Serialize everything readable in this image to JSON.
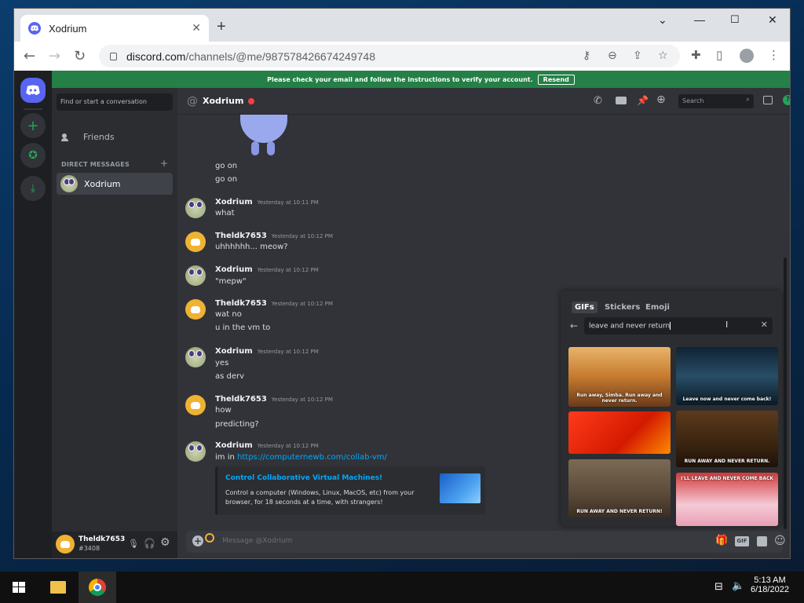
{
  "browser": {
    "tab_title": "Xodrium",
    "url_host": "discord.com",
    "url_path": "/channels/@me/987578426674249748"
  },
  "discord": {
    "banner_text": "Please check your email and follow the instructions to verify your account.",
    "banner_button": "Resend",
    "find_placeholder": "Find or start a conversation",
    "friends_label": "Friends",
    "dm_header": "DIRECT MESSAGES",
    "dm_active": "Xodrium",
    "channel_name": "Xodrium",
    "search_placeholder": "Search",
    "user_name": "Theldk7653",
    "user_tag": "#3408",
    "composer_placeholder": "Message @Xodrium",
    "messages": [
      {
        "name": "",
        "time": "",
        "lines": [
          "go on",
          "go on"
        ]
      },
      {
        "name": "Xodrium",
        "time": "Yesterday at 10:11 PM",
        "lines": [
          "what"
        ]
      },
      {
        "name": "Theldk7653",
        "time": "Yesterday at 10:12 PM",
        "lines": [
          "uhhhhhh... meow?"
        ]
      },
      {
        "name": "Xodrium",
        "time": "Yesterday at 10:12 PM",
        "lines": [
          "\"mepw\""
        ]
      },
      {
        "name": "Theldk7653",
        "time": "Yesterday at 10:12 PM",
        "lines": [
          "wat no",
          "u in the vm to"
        ]
      },
      {
        "name": "Xodrium",
        "time": "Yesterday at 10:12 PM",
        "lines": [
          "yes",
          "as derv"
        ]
      },
      {
        "name": "Theldk7653",
        "time": "Yesterday at 10:12 PM",
        "lines": [
          "how",
          "predicting?"
        ]
      },
      {
        "name": "Xodrium",
        "time": "Yesterday at 10:12 PM",
        "lines": [
          "im in"
        ],
        "link": "https://computernewb.com/collab-vm/"
      }
    ],
    "embed": {
      "title": "Control Collaborative Virtual Machines!",
      "desc": "Control a computer (Windows, Linux, MacOS, etc) from your browser, for 18 seconds at a time, with strangers!"
    },
    "gif_picker": {
      "tabs": [
        "GIFs",
        "Stickers",
        "Emoji"
      ],
      "query": "leave and never return",
      "gifs": [
        {
          "caption": "Run away, Simba. Run away and never return."
        },
        {
          "caption": "Leave now and never come back!"
        },
        {
          "caption": ""
        },
        {
          "caption": "RUN AWAY AND NEVER RETURN."
        },
        {
          "caption": "RUN AWAY AND NEVER RETURN!"
        },
        {
          "caption": "I'LL LEAVE AND NEVER COME BACK"
        }
      ]
    }
  },
  "taskbar": {
    "time": "5:13 AM",
    "date": "6/18/2022"
  }
}
